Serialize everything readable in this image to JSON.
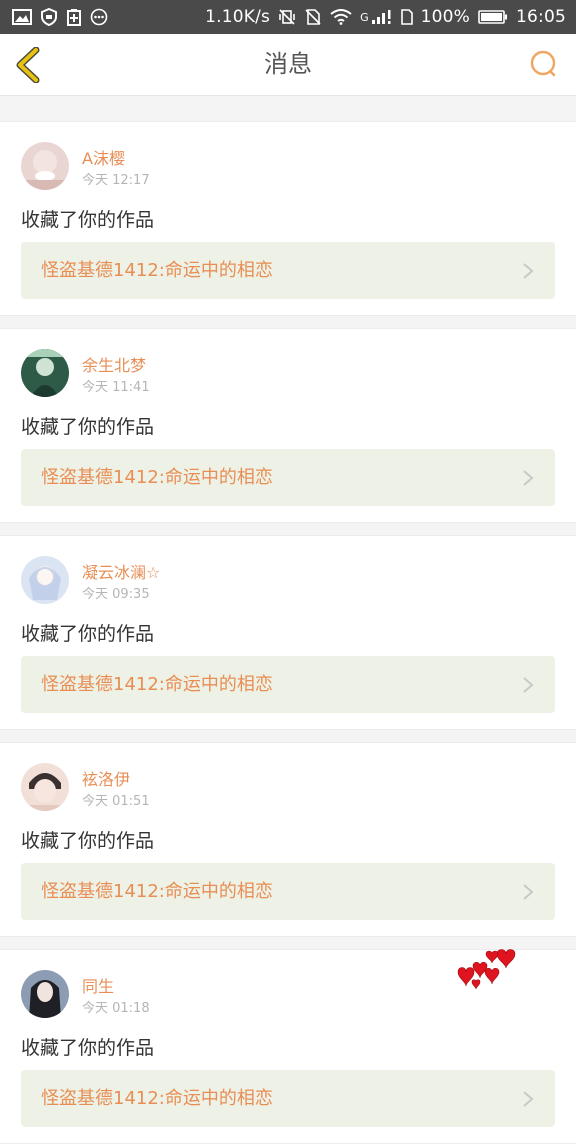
{
  "status_bar": {
    "speed": "1.10K/s",
    "network_label": "G",
    "battery": "100%",
    "time": "16:05"
  },
  "nav": {
    "title": "消息",
    "back_icon": "chevron-left-icon",
    "search_icon": "search-icon"
  },
  "colors": {
    "accent": "#e88e55",
    "back_yellow": "#e6c213",
    "link_bg": "#eef2e6"
  },
  "messages": [
    {
      "user": "A沫樱",
      "time": "今天 12:17",
      "action": "收藏了你的作品",
      "work_title": "怪盗基德1412:命运中的相恋"
    },
    {
      "user": "余生北梦",
      "time": "今天 11:41",
      "action": "收藏了你的作品",
      "work_title": "怪盗基德1412:命运中的相恋"
    },
    {
      "user": "凝云冰澜☆",
      "time": "今天 09:35",
      "action": "收藏了你的作品",
      "work_title": "怪盗基德1412:命运中的相恋"
    },
    {
      "user": "袨洛伊",
      "time": "今天 01:51",
      "action": "收藏了你的作品",
      "work_title": "怪盗基德1412:命运中的相恋"
    },
    {
      "user": "同生",
      "time": "今天 01:18",
      "action": "收藏了你的作品",
      "work_title": "怪盗基德1412:命运中的相恋"
    }
  ]
}
